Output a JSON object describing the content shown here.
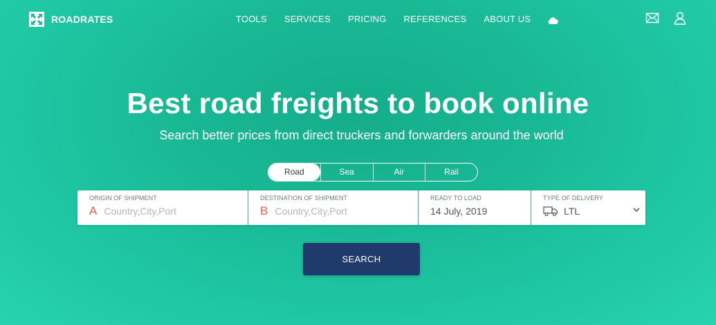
{
  "brand": {
    "name": "ROADRATES",
    "logo_icon": "expand-arrows-icon"
  },
  "nav": {
    "items": [
      {
        "label": "TOOLS"
      },
      {
        "label": "SERVICES"
      },
      {
        "label": "PRICING"
      },
      {
        "label": "REFERENCES"
      },
      {
        "label": "ABOUT US"
      }
    ],
    "weather_icon": "cloud-icon"
  },
  "header_icons": [
    "mail-icon",
    "user-icon"
  ],
  "hero": {
    "title": "Best road freights to book online",
    "subtitle": "Search better prices from direct truckers and forwarders around the world"
  },
  "modes": {
    "items": [
      {
        "label": "Road",
        "active": true
      },
      {
        "label": "Sea",
        "active": false
      },
      {
        "label": "Air",
        "active": false
      },
      {
        "label": "Rail",
        "active": false
      }
    ]
  },
  "search_form": {
    "origin": {
      "label": "ORIGIN OF SHIPMENT",
      "letter": "A",
      "placeholder": "Country,City,Port",
      "value": ""
    },
    "destination": {
      "label": "DESTINATION OF SHIPMENT",
      "letter": "B",
      "placeholder": "Country,City,Port",
      "value": ""
    },
    "ready_to_load": {
      "label": "READY TO LOAD",
      "value": "14 July, 2019"
    },
    "delivery_type": {
      "label": "TYPE OF DELIVERY",
      "value": "LTL",
      "icon": "truck-icon"
    },
    "search_label": "SEARCH"
  },
  "colors": {
    "background": "#1ab896",
    "button": "#1f3a6b",
    "letter_accent": "#f05a4f",
    "field_divider": "#3aa6d8"
  }
}
